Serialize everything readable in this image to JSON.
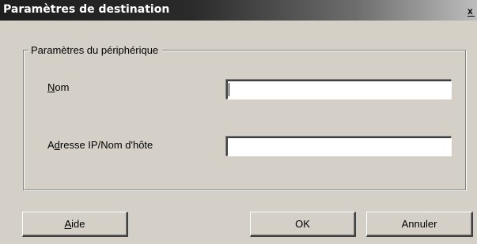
{
  "window": {
    "title": "Paramètres de destination",
    "close_glyph": "x"
  },
  "group": {
    "legend": "Paramètres du périphérique"
  },
  "fields": {
    "name": {
      "label_mnemonic": "N",
      "label_rest": "om",
      "value": ""
    },
    "address": {
      "label_pre": "A",
      "label_mnemonic": "d",
      "label_rest": "resse IP/Nom d'hôte",
      "value": ""
    }
  },
  "buttons": {
    "help": {
      "mnemonic": "A",
      "rest": "ide"
    },
    "ok": {
      "label": "OK"
    },
    "cancel": {
      "label": "Annuler"
    }
  }
}
